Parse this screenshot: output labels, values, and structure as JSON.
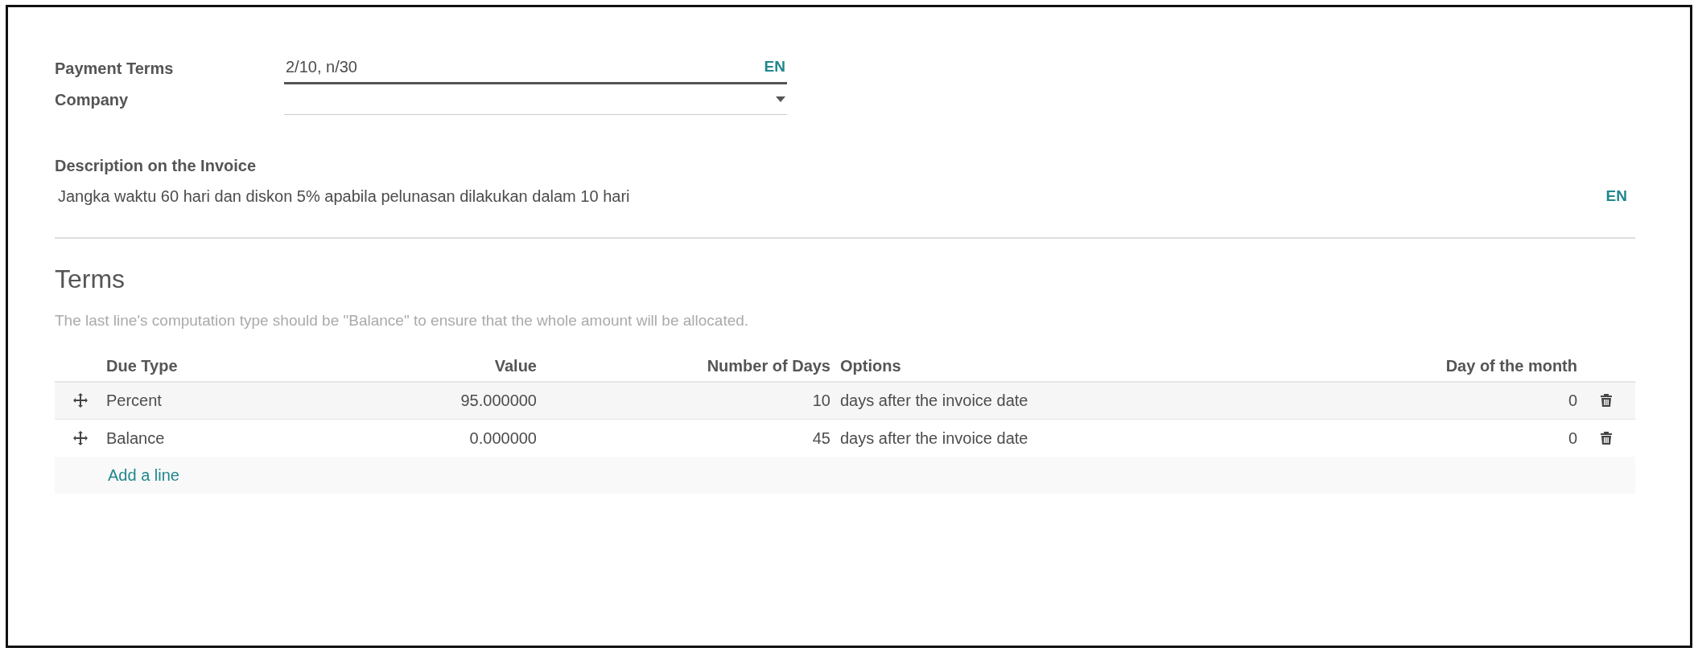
{
  "fields": [
    {
      "label": "Payment Terms",
      "value": "2/10, n/30",
      "lang": "EN",
      "kind": "text"
    },
    {
      "label": "Company",
      "kind": "select"
    }
  ],
  "description": {
    "label": "Description on the Invoice",
    "value": "Jangka waktu 60 hari dan diskon 5% apabila pelunasan dilakukan dalam 10 hari",
    "lang": "EN"
  },
  "terms": {
    "title": "Terms",
    "hint": "The last line's computation type should be \"Balance\" to ensure that the whole amount will be allocated.",
    "columns": [
      "Due Type",
      "Value",
      "Number of Days",
      "Options",
      "Day of the month"
    ],
    "rows": [
      {
        "due_type": "Percent",
        "value": "95.000000",
        "days": "10",
        "option": "days after the invoice date",
        "day_of_month": "0"
      },
      {
        "due_type": "Balance",
        "value": "0.000000",
        "days": "45",
        "option": "days after the invoice date",
        "day_of_month": "0"
      }
    ],
    "add_line": "Add a line"
  }
}
